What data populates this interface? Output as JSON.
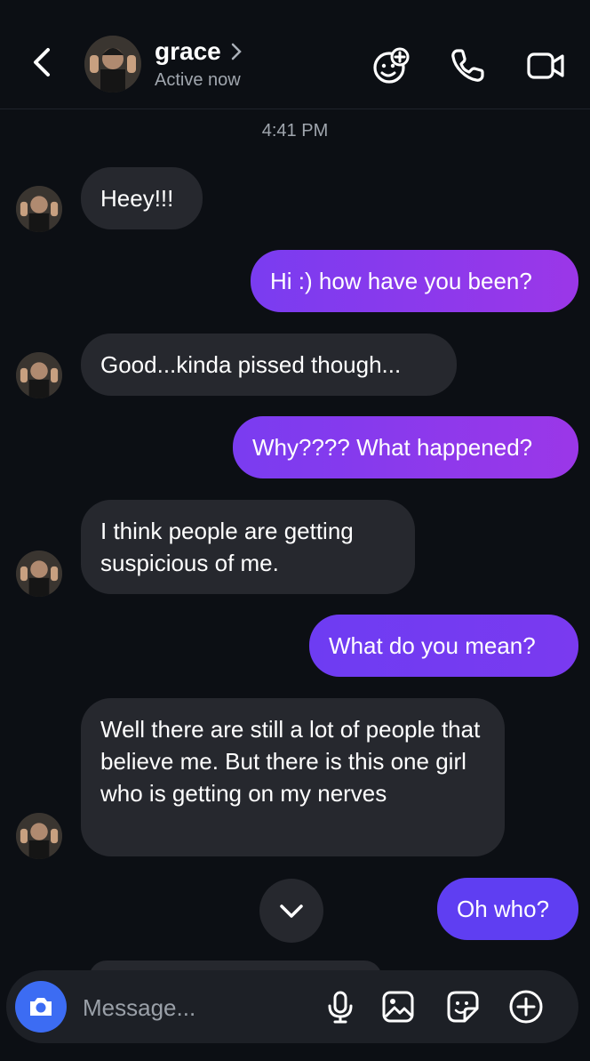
{
  "header": {
    "contact_name": "grace",
    "status": "Active now"
  },
  "timestamp": "4:41 PM",
  "messages": [
    {
      "from": "them",
      "text": "Heey!!!"
    },
    {
      "from": "me",
      "text": "Hi :) how have you been?"
    },
    {
      "from": "them",
      "text": "Good...kinda pissed though..."
    },
    {
      "from": "me",
      "text": "Why???? What happened?"
    },
    {
      "from": "them",
      "text": "I think people are getting suspicious of me."
    },
    {
      "from": "me",
      "text": "What do you mean?"
    },
    {
      "from": "them",
      "text": "Well there are still a lot of people that believe me. But there is this one girl who is getting on my nerves"
    },
    {
      "from": "me",
      "text": "Oh who?"
    }
  ],
  "composer": {
    "placeholder": "Message..."
  },
  "icons": {
    "back": "chevron-left-icon",
    "effects": "face-effects-icon",
    "call": "phone-icon",
    "video": "video-camera-icon",
    "camera": "camera-icon",
    "mic": "microphone-icon",
    "gallery": "image-icon",
    "sticker": "sticker-icon",
    "add": "plus-circle-icon",
    "scroll_down": "chevron-down-icon"
  },
  "colors": {
    "background": "#0c0f14",
    "incoming_bubble": "#26282e",
    "outgoing_bubble_start": "#7a3cf0",
    "outgoing_bubble_end": "#9b37e8",
    "camera_button": "#3c6cf3"
  }
}
